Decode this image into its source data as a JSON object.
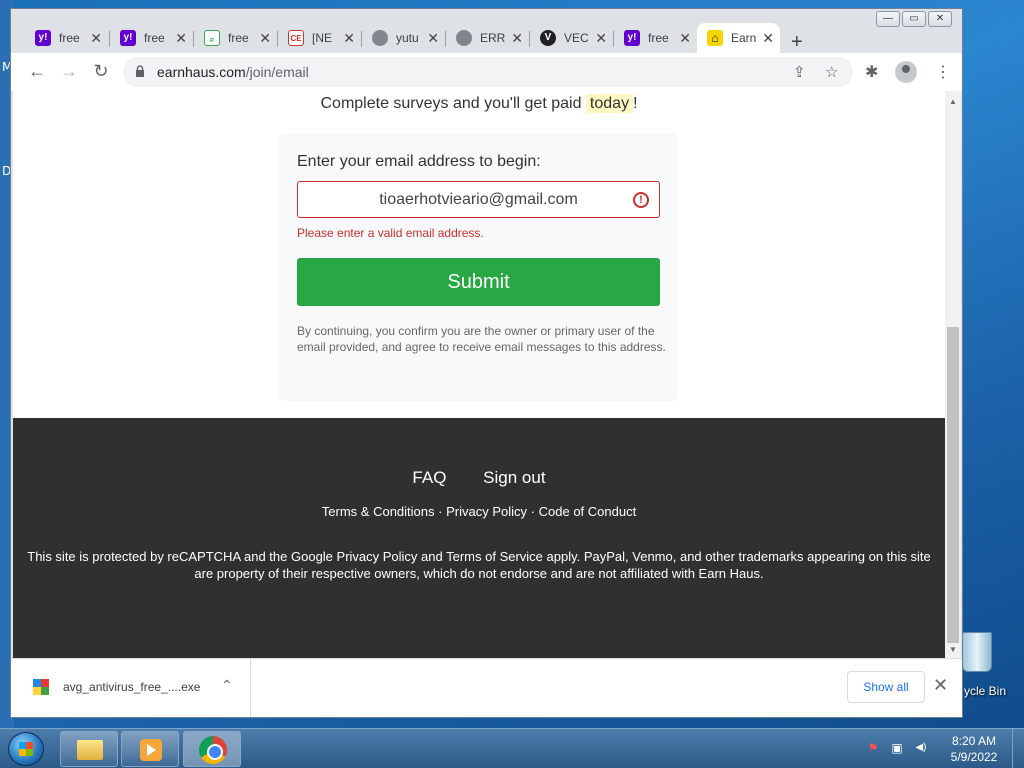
{
  "desktop": {
    "edge_letters": [
      "M",
      "D"
    ],
    "recycle_bin_label": "ycle Bin"
  },
  "window_controls": {
    "minimize": "—",
    "restore": "▭",
    "close": "✕"
  },
  "tabs": [
    {
      "title": "free",
      "favicon": "yahoo-icon",
      "favicon_color": "#6001d2",
      "favicon_glyph": "y!"
    },
    {
      "title": "free",
      "favicon": "yahoo-icon",
      "favicon_color": "#6001d2",
      "favicon_glyph": "y!"
    },
    {
      "title": "free",
      "favicon": "search-doc-icon",
      "favicon_color": "#34a853",
      "favicon_glyph": "🔍"
    },
    {
      "title": "[NE",
      "favicon": "ce-icon",
      "favicon_color": "#d32f2f",
      "favicon_glyph": "CE"
    },
    {
      "title": "yutu",
      "favicon": "globe-icon",
      "favicon_color": "#5f6368",
      "favicon_glyph": "◍"
    },
    {
      "title": "ERR",
      "favicon": "globe-icon",
      "favicon_color": "#5f6368",
      "favicon_glyph": "◍"
    },
    {
      "title": "VEC",
      "favicon": "v-icon",
      "favicon_color": "#202124",
      "favicon_glyph": "V"
    },
    {
      "title": "free",
      "favicon": "yahoo-icon",
      "favicon_color": "#6001d2",
      "favicon_glyph": "y!"
    },
    {
      "title": "Earn",
      "favicon": "earnhaus-house-icon",
      "favicon_color": "#f5d400",
      "favicon_glyph": "⌂",
      "active": true
    }
  ],
  "toolbar": {
    "url_domain": "earnhaus.com",
    "url_path": "/join/email",
    "back": "←",
    "forward": "→",
    "reload": "↻",
    "share": "⇪",
    "star": "☆",
    "extensions": "✱",
    "menu": "⋮",
    "new_tab": "+"
  },
  "page": {
    "tagline_before": "Complete surveys and you'll get paid",
    "tagline_highlight": "today",
    "tagline_after": "!",
    "prompt": "Enter your email address to begin:",
    "email_value": "tioaerhotvieario@gmail.com",
    "error_icon": "!",
    "error_message": "Please enter a valid email address.",
    "submit_label": "Submit",
    "disclaimer": "By continuing, you confirm you are the owner or primary user of the email provided, and agree to receive email messages to this address."
  },
  "footer": {
    "faq": "FAQ",
    "sign_out": "Sign out",
    "terms": "Terms & Conditions",
    "privacy": "Privacy Policy",
    "conduct": "Code of Conduct",
    "sep": "·",
    "legal": "This site is protected by reCAPTCHA and the Google Privacy Policy and Terms of Service apply. PayPal, Venmo, and other trademarks appearing on this site are property of their respective owners, which do not endorse and are not affiliated with Earn Haus."
  },
  "downloads": {
    "file_name": "avg_antivirus_free_....exe",
    "chevron": "⌃",
    "show_all": "Show all",
    "close": "✕"
  },
  "taskbar": {
    "time": "8:20 AM",
    "date": "5/9/2022",
    "tray_flag": "⚑",
    "tray_network": "▣",
    "tray_volume": "◀)"
  },
  "colors": {
    "submit_green": "#28a745",
    "error_red": "#c9302c",
    "footer_bg": "#2f3032"
  }
}
